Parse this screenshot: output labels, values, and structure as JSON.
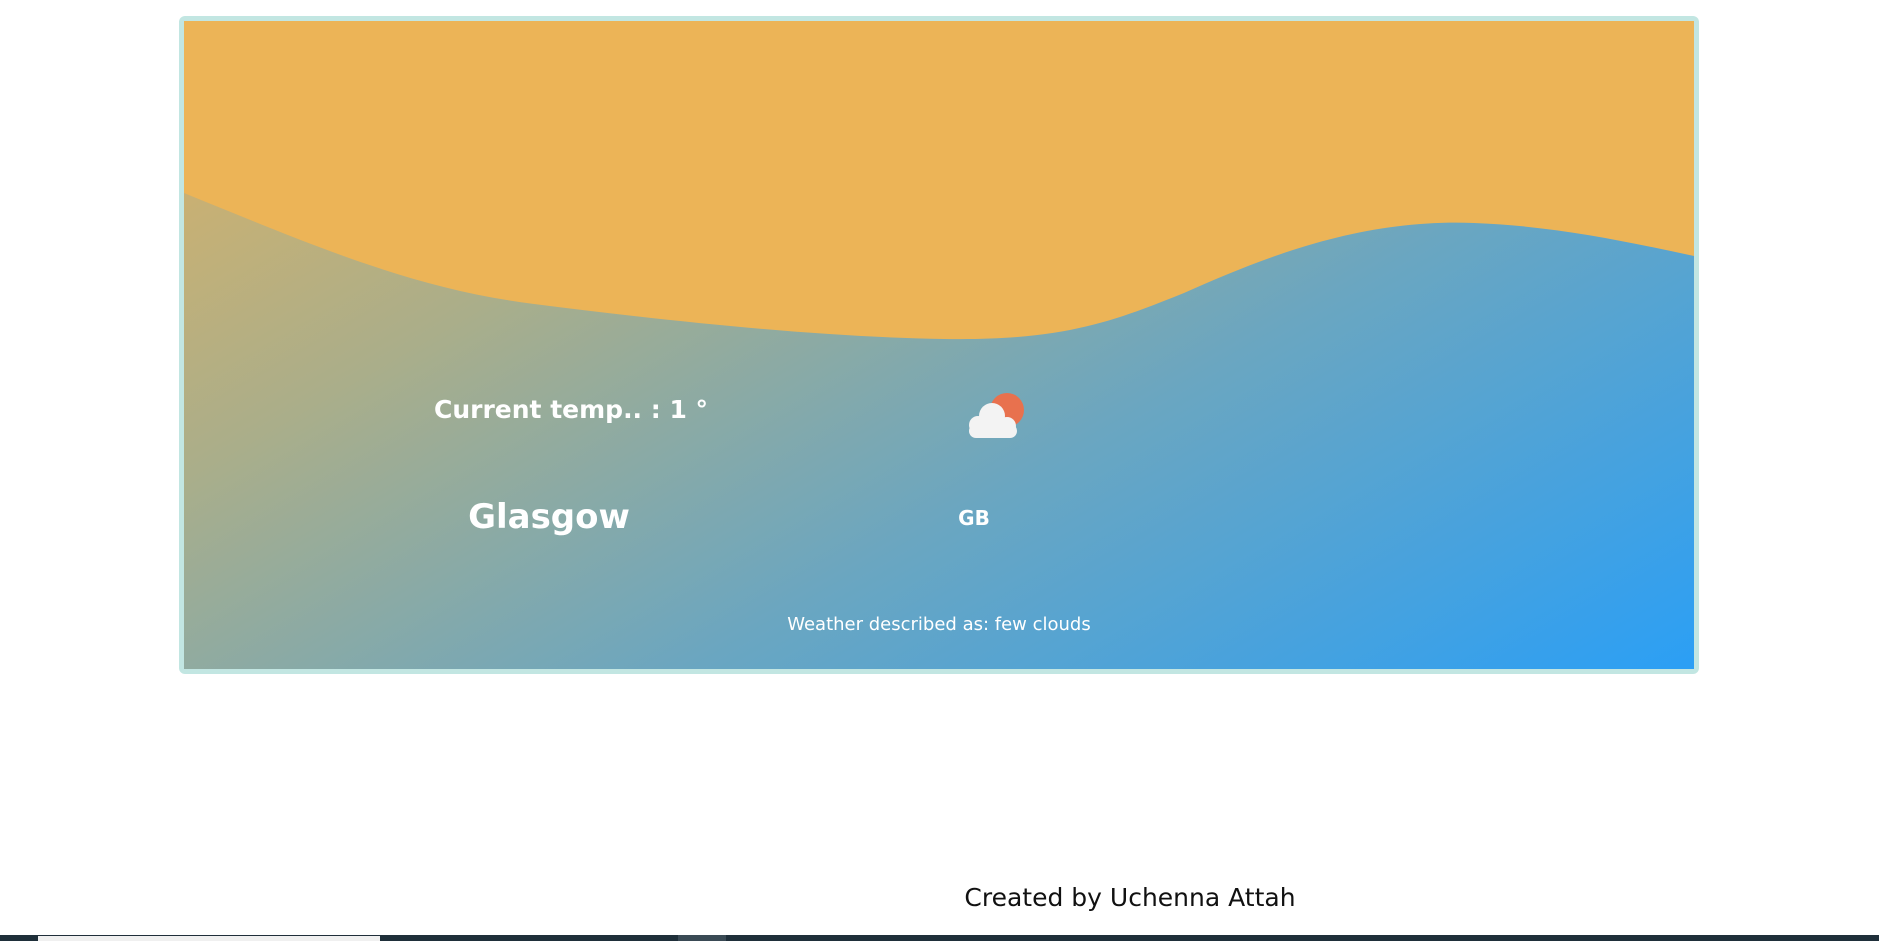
{
  "weather": {
    "temperature_label": "Current temp.. : 1 °",
    "city": "Glasgow",
    "country": "GB",
    "description_label": "Weather described as: few clouds",
    "icon": "cloud-sun-icon"
  },
  "footer": {
    "credit": "Created by Uchenna Attah"
  },
  "colors": {
    "wave": "#ecb457",
    "card_border": "#c2e6e2",
    "sun": "#e8714e",
    "cloud": "#f3f3f3",
    "gradient_end": "#2b9ff5"
  }
}
